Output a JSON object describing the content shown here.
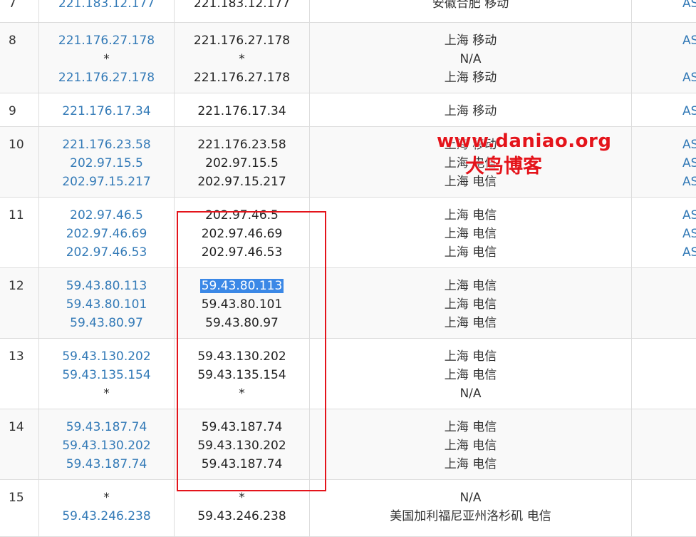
{
  "hops": [
    {
      "hop": "7",
      "ips": [
        "221.183.12.177"
      ],
      "hosts": [
        "221.183.12.177"
      ],
      "locs": [
        "安徽合肥 移动"
      ],
      "as": [
        "AS"
      ]
    },
    {
      "hop": "8",
      "ips": [
        "221.176.27.178",
        "*",
        "221.176.27.178"
      ],
      "hosts": [
        "221.176.27.178",
        "*",
        "221.176.27.178"
      ],
      "locs": [
        "上海 移动",
        "N/A",
        "上海 移动"
      ],
      "as": [
        "AS",
        "",
        "AS"
      ]
    },
    {
      "hop": "9",
      "ips": [
        "221.176.17.34"
      ],
      "hosts": [
        "221.176.17.34"
      ],
      "locs": [
        "上海 移动"
      ],
      "as": [
        "AS"
      ]
    },
    {
      "hop": "10",
      "ips": [
        "221.176.23.58",
        "202.97.15.5",
        "202.97.15.217"
      ],
      "hosts": [
        "221.176.23.58",
        "202.97.15.5",
        "202.97.15.217"
      ],
      "locs": [
        "上海 移动",
        "上海 电信",
        "上海 电信"
      ],
      "as": [
        "AS",
        "AS",
        "AS"
      ]
    },
    {
      "hop": "11",
      "ips": [
        "202.97.46.5",
        "202.97.46.69",
        "202.97.46.53"
      ],
      "hosts": [
        "202.97.46.5",
        "202.97.46.69",
        "202.97.46.53"
      ],
      "locs": [
        "上海 电信",
        "上海 电信",
        "上海 电信"
      ],
      "as": [
        "AS",
        "AS",
        "AS"
      ]
    },
    {
      "hop": "12",
      "ips": [
        "59.43.80.113",
        "59.43.80.101",
        "59.43.80.97"
      ],
      "hosts": [
        "59.43.80.113",
        "59.43.80.101",
        "59.43.80.97"
      ],
      "locs": [
        "上海 电信",
        "上海 电信",
        "上海 电信"
      ],
      "as": []
    },
    {
      "hop": "13",
      "ips": [
        "59.43.130.202",
        "59.43.135.154",
        "*"
      ],
      "hosts": [
        "59.43.130.202",
        "59.43.135.154",
        "*"
      ],
      "locs": [
        "上海 电信",
        "上海 电信",
        "N/A"
      ],
      "as": []
    },
    {
      "hop": "14",
      "ips": [
        "59.43.187.74",
        "59.43.130.202",
        "59.43.187.74"
      ],
      "hosts": [
        "59.43.187.74",
        "59.43.130.202",
        "59.43.187.74"
      ],
      "locs": [
        "上海 电信",
        "上海 电信",
        "上海 电信"
      ],
      "as": []
    },
    {
      "hop": "15",
      "ips": [
        "*",
        "59.43.246.238"
      ],
      "hosts": [
        "*",
        "59.43.246.238"
      ],
      "locs": [
        "N/A",
        "美国加利福尼亚州洛杉矶 电信"
      ],
      "as": []
    }
  ],
  "selected_host": "59.43.80.113",
  "watermark": {
    "url": "www.daniao.org",
    "name": "大鸟博客"
  },
  "colors": {
    "link": "#337ab7",
    "highlight_box": "#e4141b",
    "selection": "#3b88e6",
    "stripe": "#f9f9f9"
  }
}
